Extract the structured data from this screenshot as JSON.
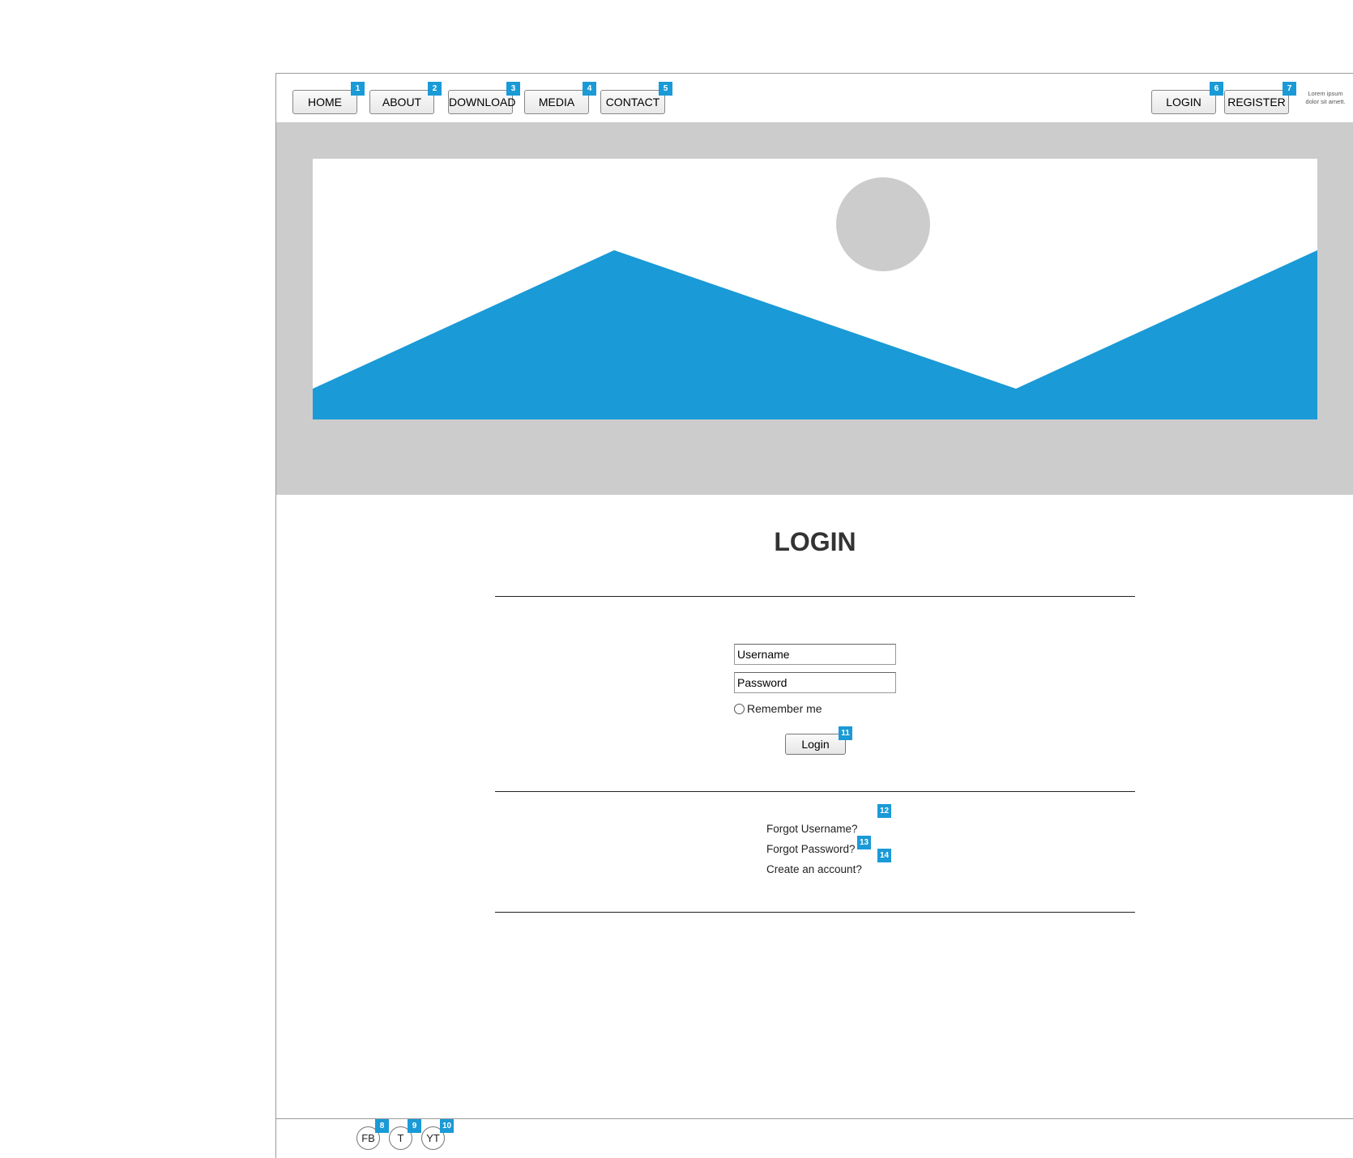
{
  "nav": {
    "items": [
      {
        "label": "HOME",
        "badge": "1"
      },
      {
        "label": "ABOUT",
        "badge": "2"
      },
      {
        "label": "DOWNLOAD",
        "badge": "3"
      },
      {
        "label": "MEDIA",
        "badge": "4"
      },
      {
        "label": "CONTACT",
        "badge": "5"
      }
    ],
    "login": {
      "label": "LOGIN",
      "badge": "6"
    },
    "register": {
      "label": "REGISTER",
      "badge": "7"
    },
    "note_line1": "Lorem ipsum",
    "note_line2": "dolor sit amett."
  },
  "hero": {
    "image": "image-placeholder-icon",
    "accent": "#1a9ad6",
    "bg": "#cccccc"
  },
  "login_form": {
    "title": "LOGIN",
    "username_placeholder": "Username",
    "password_placeholder": "Password",
    "remember_label": "Remember me",
    "submit_label": "Login",
    "submit_badge": "11"
  },
  "links": {
    "forgot_username": "Forgot Username?",
    "forgot_username_badge": "12",
    "forgot_password": "Forgot Password?",
    "forgot_password_badge": "13",
    "create_account": "Create an account?",
    "create_account_badge": "14"
  },
  "footer": {
    "social": [
      {
        "label": "FB",
        "badge": "8"
      },
      {
        "label": "T",
        "badge": "9"
      },
      {
        "label": "YT",
        "badge": "10"
      }
    ]
  }
}
